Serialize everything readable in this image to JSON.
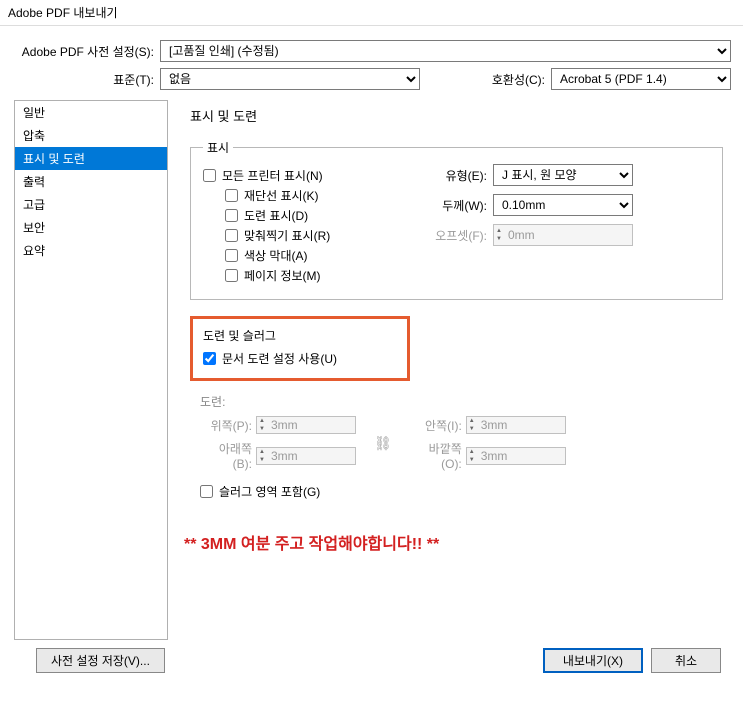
{
  "window": {
    "title": "Adobe PDF 내보내기"
  },
  "preset": {
    "label": "Adobe PDF 사전 설정(S):",
    "value": "[고품질 인쇄] (수정됨)"
  },
  "standard": {
    "label": "표준(T):",
    "value": "없음"
  },
  "compat": {
    "label": "호환성(C):",
    "value": "Acrobat 5 (PDF 1.4)"
  },
  "sidebar": {
    "items": [
      {
        "label": "일반"
      },
      {
        "label": "압축"
      },
      {
        "label": "표시 및 도련"
      },
      {
        "label": "출력"
      },
      {
        "label": "고급"
      },
      {
        "label": "보안"
      },
      {
        "label": "요약"
      }
    ],
    "selected_index": 2
  },
  "content": {
    "title": "표시 및 도련",
    "marks_group": {
      "legend": "표시",
      "all_printer_marks": "모든 프린터 표시(N)",
      "crop_marks": "재단선 표시(K)",
      "bleed_marks": "도련 표시(D)",
      "registration_marks": "맞춰찍기 표시(R)",
      "color_bars": "색상 막대(A)",
      "page_info": "페이지 정보(M)",
      "type_label": "유형(E):",
      "type_value": "J 표시, 원 모양",
      "weight_label": "두께(W):",
      "weight_value": "0.10mm",
      "offset_label": "오프셋(F):",
      "offset_value": "0mm"
    },
    "bleed_group": {
      "legend_area": "도련 및 슬러그",
      "use_doc_bleed": "문서 도련 설정 사용(U)",
      "bleed_sub": "도련:",
      "top_label": "위쪽(P):",
      "bottom_label": "아래쪽(B):",
      "inside_label": "안쪽(I):",
      "outside_label": "바깥쪽(O):",
      "top_val": "3mm",
      "bottom_val": "3mm",
      "inside_val": "3mm",
      "outside_val": "3mm",
      "include_slug": "슬러그 영역 포함(G)"
    },
    "warning_text": "** 3MM 여분 주고 작업해야합니다!! **"
  },
  "buttons": {
    "save_preset": "사전 설정 저장(V)...",
    "export": "내보내기(X)",
    "cancel": "취소"
  }
}
